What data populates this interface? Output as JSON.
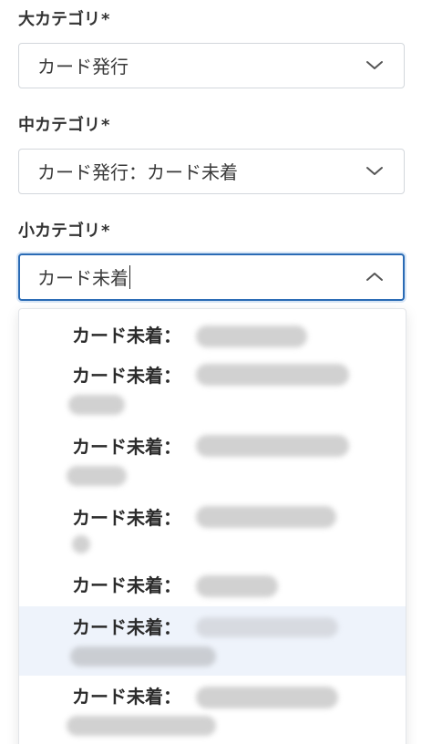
{
  "fields": {
    "major": {
      "label": "大カテゴリ",
      "required_mark": "*",
      "value": "カード発行"
    },
    "middle": {
      "label": "中カテゴリ",
      "required_mark": "*",
      "value": "カード発行：カード未着"
    },
    "minor": {
      "label": "小カテゴリ",
      "required_mark": "*",
      "value": "カード未着"
    }
  },
  "dropdown": {
    "options": [
      {
        "label": "カード未着："
      },
      {
        "label": "カード未着："
      },
      {
        "label": "カード未着："
      },
      {
        "label": "カード未着："
      },
      {
        "label": "カード未着："
      },
      {
        "label": "カード未着：",
        "highlighted": true
      },
      {
        "label": "カード未着："
      }
    ]
  },
  "colors": {
    "focus_border": "#2a6bb5",
    "highlight_bg": "#eef3fb"
  },
  "icons": {
    "collapsed": "chevron-down-icon",
    "expanded": "chevron-up-icon"
  }
}
